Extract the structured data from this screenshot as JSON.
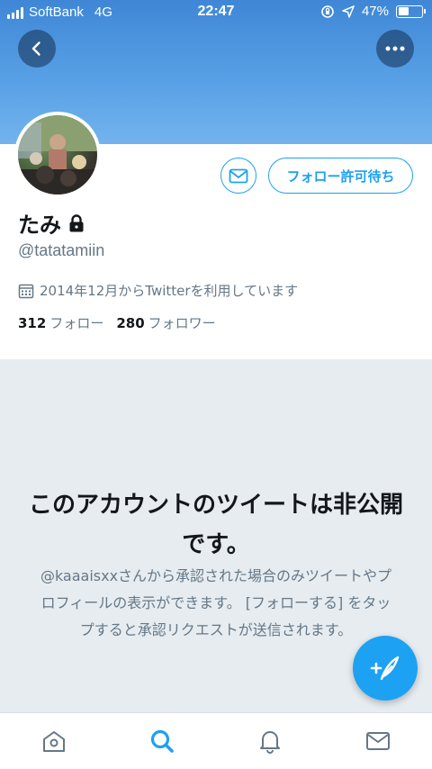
{
  "status_bar": {
    "carrier": "SoftBank",
    "network": "4G",
    "time": "22:47",
    "battery": "47%",
    "battery_level": 0.47
  },
  "header": {
    "back_icon": "chevron-left-icon",
    "more_icon": "ellipsis-icon",
    "banner_color": "#4a93dd"
  },
  "profile": {
    "display_name": "たみ",
    "protected_icon": "lock-icon",
    "handle": "@tatatamiin",
    "joined_text": "2014年12月からTwitterを利用しています",
    "following_count": "312",
    "following_label": "フォロー",
    "followers_count": "280",
    "followers_label": "フォロワー"
  },
  "actions": {
    "message_icon": "envelope-icon",
    "follow_pending_label": "フォロー許可待ち"
  },
  "notice": {
    "title": "このアカウントのツイートは非公開です。",
    "body": "@kaaaisxxさんから承認された場合のみツイートやプロフィールの表示ができます。 [フォローする] をタップすると承認リクエストが送信されます。"
  },
  "fab": {
    "icon": "compose-tweet-icon"
  },
  "tab_bar": {
    "tabs": [
      {
        "icon": "home-icon",
        "active": false
      },
      {
        "icon": "search-icon",
        "active": true
      },
      {
        "icon": "notifications-bell-icon",
        "active": false
      },
      {
        "icon": "messages-envelope-icon",
        "active": false
      }
    ]
  },
  "colors": {
    "accent": "#1da1f2",
    "secondary_text": "#657786",
    "notice_background": "#e6ecf0"
  }
}
